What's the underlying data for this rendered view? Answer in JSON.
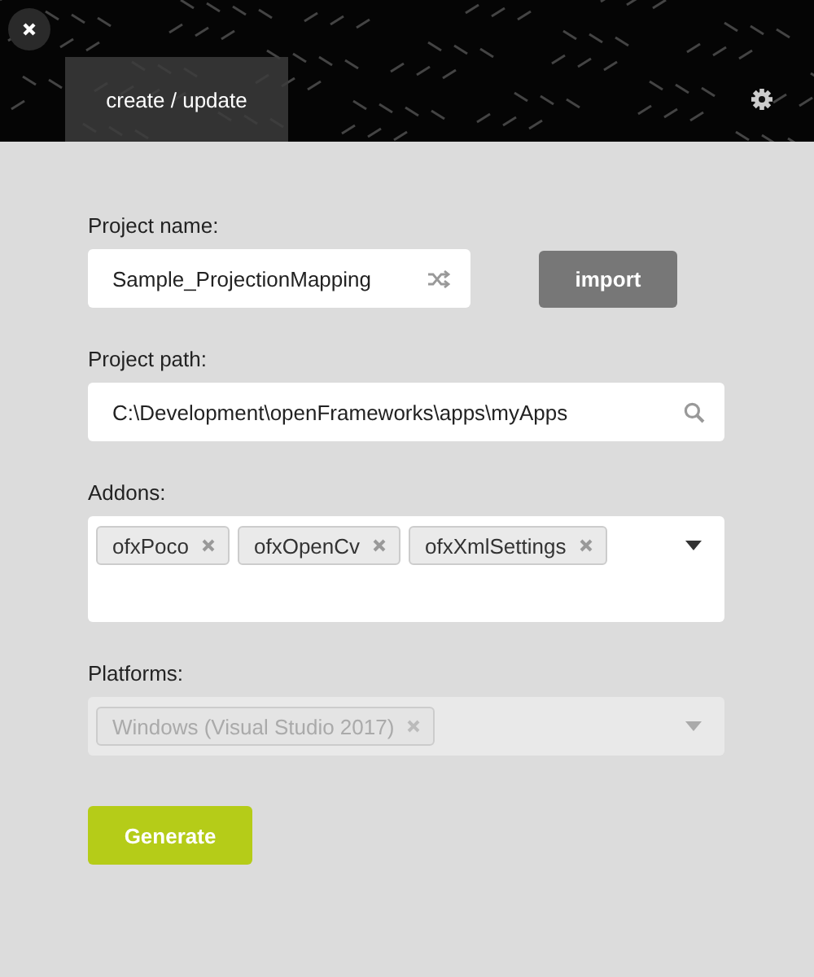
{
  "tabs": [
    {
      "label": "create / update",
      "selected": true
    }
  ],
  "project_name": {
    "label": "Project name:",
    "value": "Sample_ProjectionMapping"
  },
  "import_button": "import",
  "project_path": {
    "label": "Project path:",
    "value": "C:\\Development\\openFrameworks\\apps\\myApps"
  },
  "addons": {
    "label": "Addons:",
    "disabled": false,
    "tags": [
      "ofxPoco",
      "ofxOpenCv",
      "ofxXmlSettings"
    ]
  },
  "platforms": {
    "label": "Platforms:",
    "disabled": true,
    "tags": [
      "Windows (Visual Studio 2017)"
    ]
  },
  "generate_button": "Generate"
}
